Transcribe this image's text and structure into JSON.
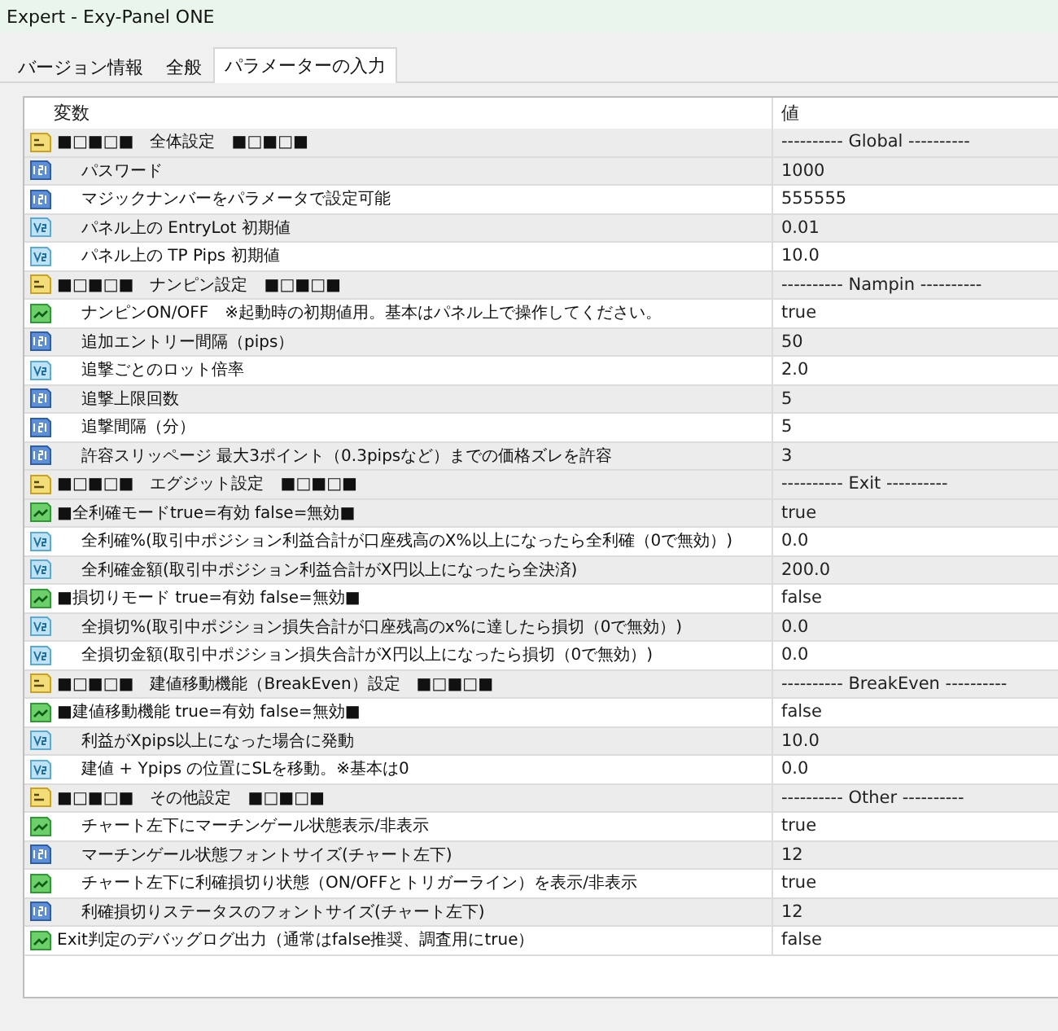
{
  "window": {
    "title": "Expert - Exy-Panel ONE"
  },
  "tabs": [
    {
      "label": "バージョン情報",
      "selected": false
    },
    {
      "label": "全般",
      "selected": false
    },
    {
      "label": "パラメーターの入力",
      "selected": true
    }
  ],
  "table": {
    "columns": [
      "変数",
      "値"
    ],
    "rows": [
      {
        "kind": "string",
        "indented": false,
        "name": "■□■□■　全体設定　■□■□■",
        "value": "---------- Global ----------"
      },
      {
        "kind": "int",
        "indented": true,
        "name": "パスワード",
        "value": "1000"
      },
      {
        "kind": "int",
        "indented": true,
        "name": "マジックナンバーをパラメータで設定可能",
        "value": "555555"
      },
      {
        "kind": "double",
        "indented": true,
        "name": "パネル上の EntryLot 初期値",
        "value": "0.01"
      },
      {
        "kind": "double",
        "indented": true,
        "name": "パネル上の TP Pips 初期値",
        "value": "10.0"
      },
      {
        "kind": "string",
        "indented": false,
        "name": "■□■□■　ナンピン設定　■□■□■",
        "value": "---------- Nampin ----------"
      },
      {
        "kind": "bool",
        "indented": true,
        "name": "ナンピンON/OFF　※起動時の初期値用。基本はパネル上で操作してください。",
        "value": "true"
      },
      {
        "kind": "int",
        "indented": true,
        "name": "追加エントリー間隔（pips）",
        "value": "50"
      },
      {
        "kind": "double",
        "indented": true,
        "name": "追撃ごとのロット倍率",
        "value": "2.0"
      },
      {
        "kind": "int",
        "indented": true,
        "name": "追撃上限回数",
        "value": "5"
      },
      {
        "kind": "int",
        "indented": true,
        "name": "追撃間隔（分）",
        "value": "5"
      },
      {
        "kind": "int",
        "indented": true,
        "name": "許容スリッページ 最大3ポイント（0.3pipsなど）までの価格ズレを許容",
        "value": "3"
      },
      {
        "kind": "string",
        "indented": false,
        "name": "■□■□■　エグジット設定　■□■□■",
        "value": "---------- Exit ----------"
      },
      {
        "kind": "bool",
        "indented": false,
        "name": "■全利確モードtrue=有効 false=無効■",
        "value": "true"
      },
      {
        "kind": "double",
        "indented": true,
        "name": "全利確%(取引中ポジション利益合計が口座残高のX%以上になったら全利確（0で無効）)",
        "value": "0.0"
      },
      {
        "kind": "double",
        "indented": true,
        "name": "全利確金額(取引中ポジション利益合計がX円以上になったら全決済)",
        "value": "200.0"
      },
      {
        "kind": "bool",
        "indented": false,
        "name": "■損切りモード true=有効 false=無効■",
        "value": "false"
      },
      {
        "kind": "double",
        "indented": true,
        "name": "全損切%(取引中ポジション損失合計が口座残高のx%に達したら損切（0で無効）)",
        "value": "0.0"
      },
      {
        "kind": "double",
        "indented": true,
        "name": "全損切金額(取引中ポジション損失合計がX円以上になったら損切（0で無効）)",
        "value": "0.0"
      },
      {
        "kind": "string",
        "indented": false,
        "name": "■□■□■　建値移動機能（BreakEven）設定　■□■□■",
        "value": "---------- BreakEven ----------"
      },
      {
        "kind": "bool",
        "indented": false,
        "name": "■建値移動機能 true=有効 false=無効■",
        "value": "false"
      },
      {
        "kind": "double",
        "indented": true,
        "name": "利益がXpips以上になった場合に発動",
        "value": "10.0"
      },
      {
        "kind": "double",
        "indented": true,
        "name": "建値 + Ypips の位置にSLを移動。※基本は0",
        "value": "0.0"
      },
      {
        "kind": "string",
        "indented": false,
        "name": "■□■□■　その他設定　■□■□■",
        "value": "---------- Other ----------"
      },
      {
        "kind": "bool",
        "indented": true,
        "name": "チャート左下にマーチンゲール状態表示/非表示",
        "value": "true"
      },
      {
        "kind": "int",
        "indented": true,
        "name": "マーチンゲール状態フォントサイズ(チャート左下)",
        "value": "12"
      },
      {
        "kind": "bool",
        "indented": true,
        "name": "チャート左下に利確損切り状態（ON/OFFとトリガーライン）を表示/非表示",
        "value": "true"
      },
      {
        "kind": "int",
        "indented": true,
        "name": "利確損切りステータスのフォントサイズ(チャート左下)",
        "value": "12"
      },
      {
        "kind": "bool",
        "indented": false,
        "name": "Exit判定のデバッグログ出力（通常はfalse推奨、調査用にtrue）",
        "value": "false"
      }
    ]
  }
}
